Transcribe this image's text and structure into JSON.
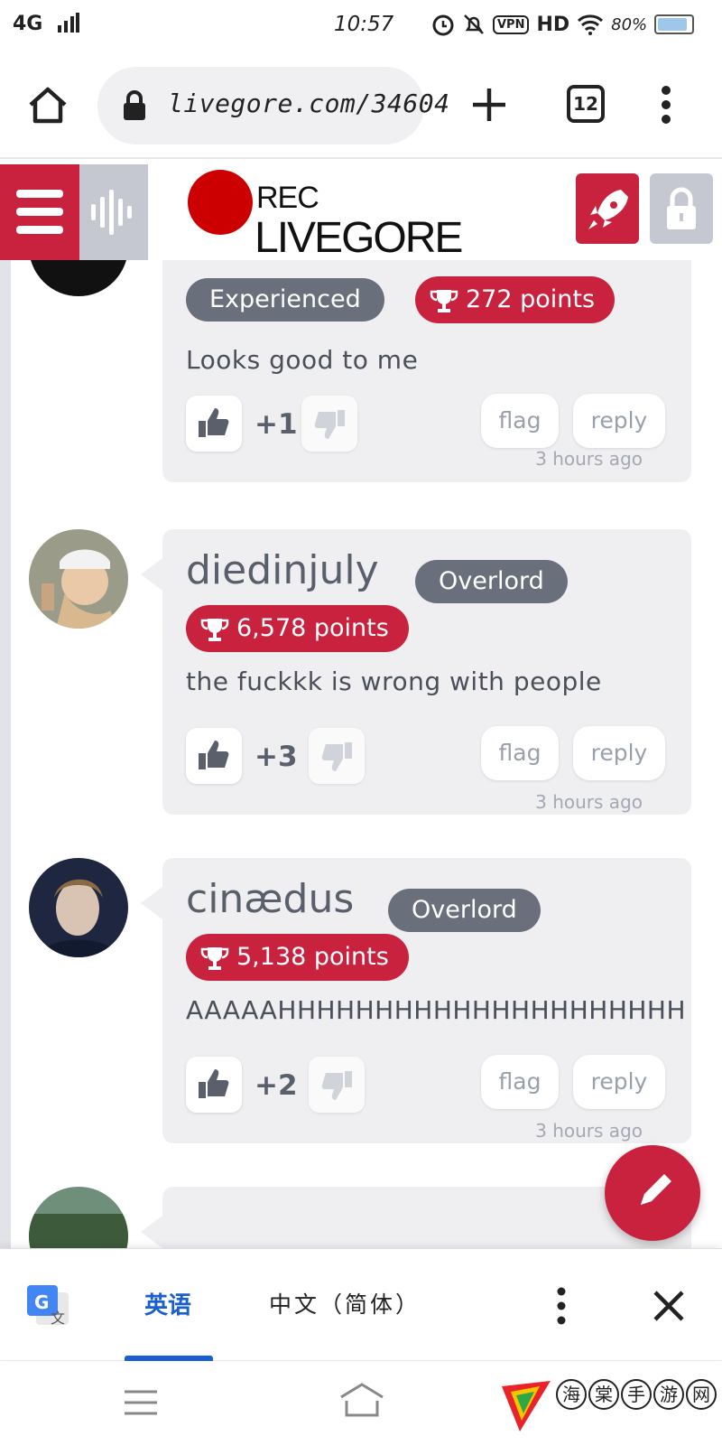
{
  "status_bar": {
    "network": "4G",
    "time": "10:57",
    "vpn": "VPN",
    "hd": "HD",
    "battery": "80%"
  },
  "browser": {
    "url": "livegore.com/34604",
    "tab_count": "12"
  },
  "site": {
    "logo_rec": "REC",
    "logo_name": "LIVEGORE"
  },
  "comments": [
    {
      "username": "",
      "rank": "Experienced",
      "points": "272 points",
      "text": "Looks good to me",
      "votes": "+1",
      "flag": "flag",
      "reply": "reply",
      "time": "3 hours ago"
    },
    {
      "username": "diedinjuly",
      "rank": "Overlord",
      "points": "6,578 points",
      "text": "the fuckkk is wrong with people",
      "votes": "+3",
      "flag": "flag",
      "reply": "reply",
      "time": "3 hours ago"
    },
    {
      "username": "cinædus",
      "rank": "Overlord",
      "points": "5,138 points",
      "text": "AAAAAHHHHHHHHHHHHHHHHHHHHH",
      "votes": "+2",
      "flag": "flag",
      "reply": "reply",
      "time": "3 hours ago"
    }
  ],
  "translate_bar": {
    "source_lang": "英语",
    "target_lang": "中文（简体）"
  },
  "watermark": {
    "chars": [
      "海",
      "棠",
      "手",
      "游",
      "网"
    ]
  },
  "colors": {
    "brand_red": "#c8223f",
    "rank_gray": "#6a6f7c",
    "bubble_bg": "#efeff2"
  }
}
